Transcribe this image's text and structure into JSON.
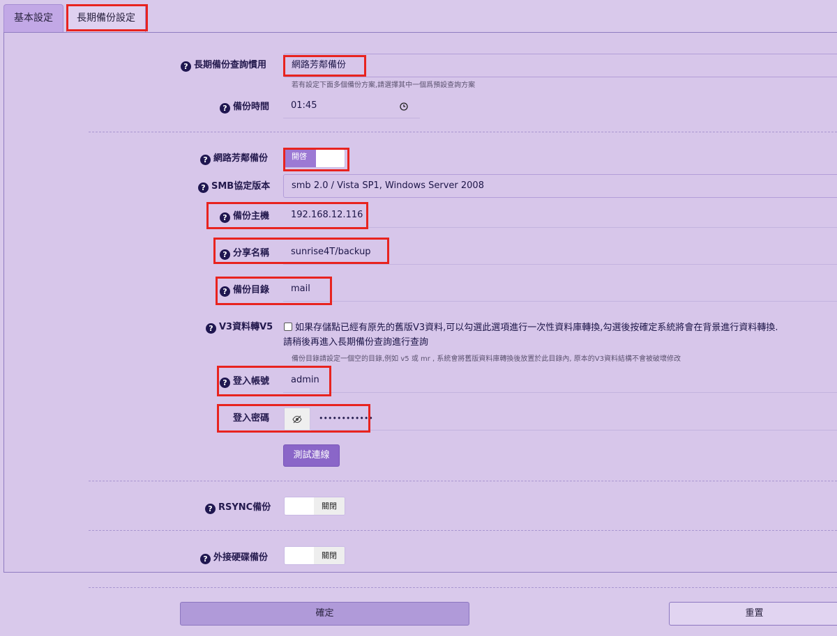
{
  "tabs": {
    "basic": "基本設定",
    "archive": "長期備份設定"
  },
  "query_preference": {
    "label": "長期備份查詢慣用",
    "value": "網路芳鄰備份",
    "hint": "若有設定下面多個備份方案,請選擇其中一個爲預設查詢方案"
  },
  "backup_time": {
    "label": "備份時間",
    "value": "01:45"
  },
  "network_backup": {
    "label": "網路芳鄰備份",
    "toggle_label": "開啓",
    "state": "on"
  },
  "smb_version": {
    "label": "SMB協定版本",
    "value": "smb 2.0 / Vista SP1, Windows Server 2008"
  },
  "backup_host": {
    "label": "備份主機",
    "value": "192.168.12.116"
  },
  "share_name": {
    "label": "分享名稱",
    "value": "sunrise4T/backup"
  },
  "backup_dir": {
    "label": "備份目錄",
    "value": "mail"
  },
  "v3_to_v5": {
    "label": "V3資料轉V5",
    "checked": false,
    "text_line1": "如果存儲點已經有原先的舊版V3資料,可以勾選此選項進行一次性資料庫轉換,勾選後按確定系統將會在背景進行資料轉換.",
    "text_line2": "請稍後再進入長期備份查詢進行查詢",
    "hint": "備份目錄請設定一個空的目錄,例如 v5 或 mr , 系統會將舊版資料庫轉換後放置於此目錄內,   原本的V3資料結構不會被破壞修改"
  },
  "login_account": {
    "label": "登入帳號",
    "value": "admin"
  },
  "login_password": {
    "label": "登入密碼",
    "value": "••••••••••••"
  },
  "test_button": "測試連線",
  "rsync_backup": {
    "label": "RSYNC備份",
    "toggle_label": "關閉",
    "state": "off"
  },
  "external_disk_backup": {
    "label": "外接硬碟備份",
    "toggle_label": "關閉",
    "state": "off"
  },
  "confirm_button": "確定",
  "reset_button": "重置",
  "colors": {
    "background": "#d9c9eb",
    "accent": "#8a66c8",
    "highlight_box": "#e8231f"
  },
  "icons": [
    "question-icon",
    "clock-icon",
    "eye-slash-icon"
  ]
}
